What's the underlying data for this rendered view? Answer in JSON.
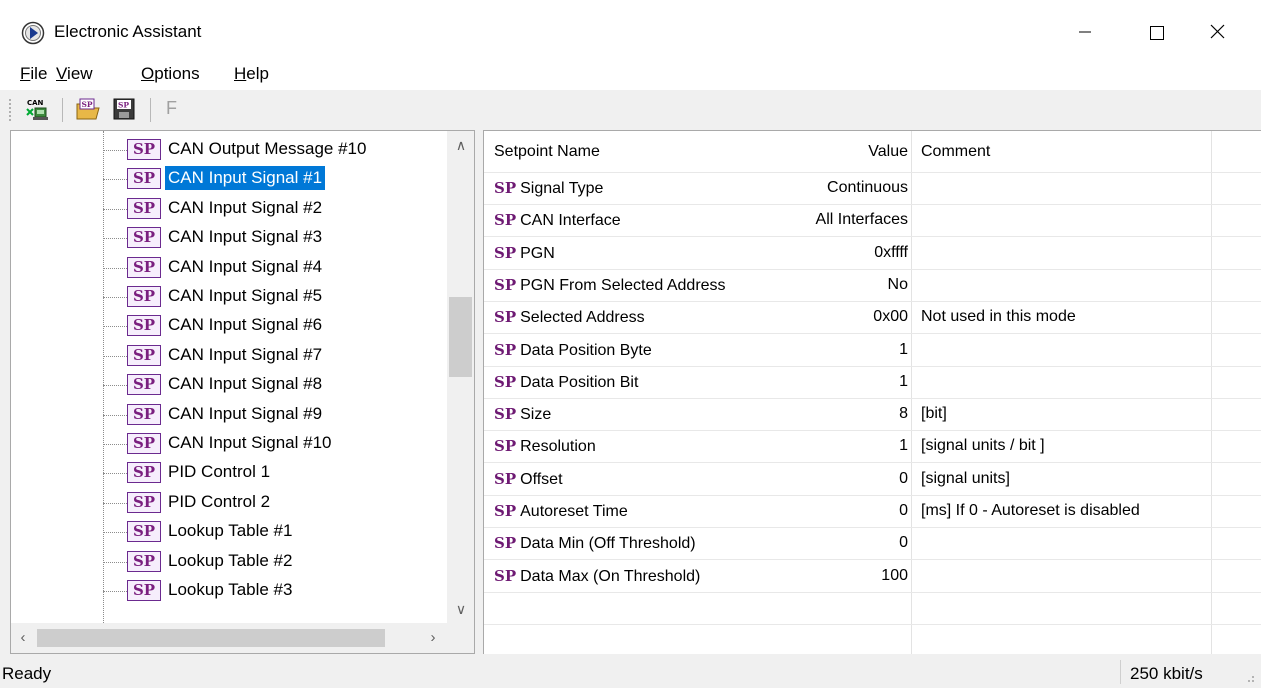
{
  "window": {
    "title": "Electronic Assistant",
    "app_icon": "electronic-assistant-icon",
    "controls": {
      "minimize": "minimize-icon",
      "maximize": "maximize-icon",
      "close": "close-icon"
    }
  },
  "menu": [
    {
      "mnemonic": "F",
      "rest": "ile"
    },
    {
      "mnemonic": "V",
      "rest": "iew"
    },
    {
      "mnemonic": "O",
      "rest": "ptions"
    },
    {
      "mnemonic": "H",
      "rest": "elp"
    }
  ],
  "toolbar": {
    "buttons": [
      "can-connect-icon",
      "sp-open-icon",
      "sp-save-icon"
    ],
    "f_label": "F"
  },
  "tree": {
    "icon_text": "SP",
    "items": [
      {
        "label": "CAN Output Message #10",
        "selected": false
      },
      {
        "label": "CAN Input Signal #1",
        "selected": true
      },
      {
        "label": "CAN Input Signal #2",
        "selected": false
      },
      {
        "label": "CAN Input Signal #3",
        "selected": false
      },
      {
        "label": "CAN Input Signal #4",
        "selected": false
      },
      {
        "label": "CAN Input Signal #5",
        "selected": false
      },
      {
        "label": "CAN Input Signal #6",
        "selected": false
      },
      {
        "label": "CAN Input Signal #7",
        "selected": false
      },
      {
        "label": "CAN Input Signal #8",
        "selected": false
      },
      {
        "label": "CAN Input Signal #9",
        "selected": false
      },
      {
        "label": "CAN Input Signal #10",
        "selected": false
      },
      {
        "label": "PID Control 1",
        "selected": false
      },
      {
        "label": "PID Control 2",
        "selected": false
      },
      {
        "label": "Lookup Table #1",
        "selected": false
      },
      {
        "label": "Lookup Table #2",
        "selected": false
      },
      {
        "label": "Lookup Table #3",
        "selected": false
      }
    ]
  },
  "grid": {
    "columns": [
      "Setpoint Name",
      "Value",
      "Comment"
    ],
    "prefix": "SP",
    "rows": [
      {
        "name": "Signal Type",
        "value": "Continuous",
        "comment": ""
      },
      {
        "name": "CAN Interface",
        "value": "All Interfaces",
        "comment": ""
      },
      {
        "name": "PGN",
        "value": "0xffff",
        "comment": ""
      },
      {
        "name": "PGN From Selected Address",
        "value": "No",
        "comment": ""
      },
      {
        "name": "Selected Address",
        "value": "0x00",
        "comment": "Not used in this mode"
      },
      {
        "name": "Data Position Byte",
        "value": "1",
        "comment": ""
      },
      {
        "name": "Data Position Bit",
        "value": "1",
        "comment": ""
      },
      {
        "name": "Size",
        "value": "8",
        "comment": "[bit]"
      },
      {
        "name": "Resolution",
        "value": "1",
        "comment": "[signal units / bit ]"
      },
      {
        "name": "Offset",
        "value": "0",
        "comment": "[signal units]"
      },
      {
        "name": "Autoreset Time",
        "value": "0",
        "comment": "[ms]  If 0 - Autoreset is disabled"
      },
      {
        "name": "Data Min (Off Threshold)",
        "value": "0",
        "comment": ""
      },
      {
        "name": "Data Max (On Threshold)",
        "value": "100",
        "comment": ""
      }
    ]
  },
  "status": {
    "left": "Ready",
    "right": "250 kbit/s"
  }
}
